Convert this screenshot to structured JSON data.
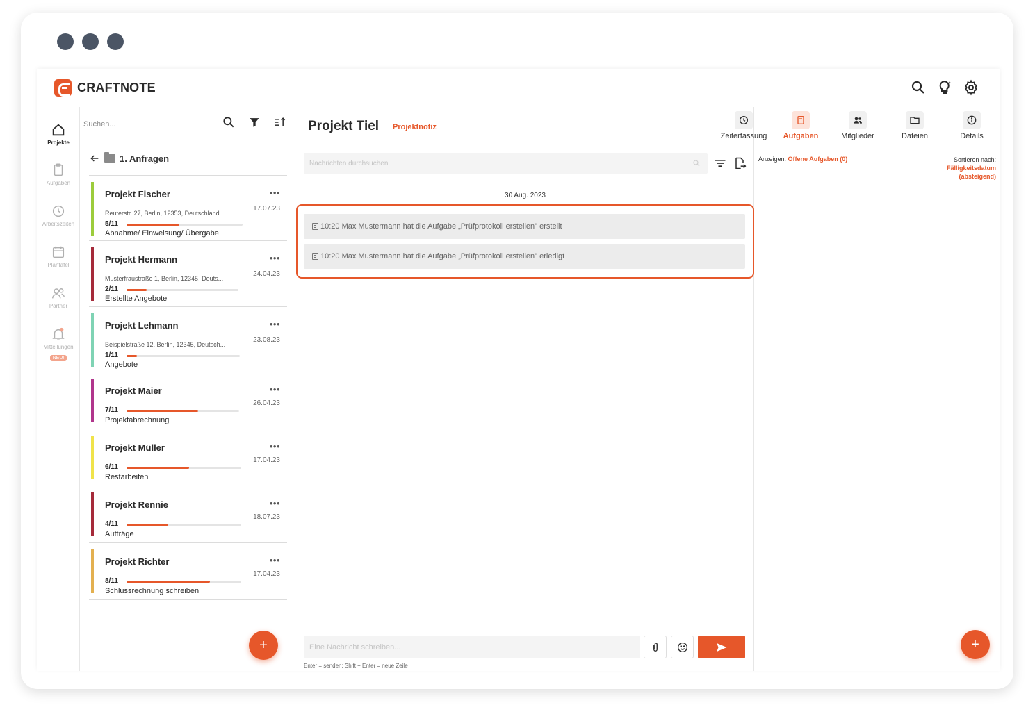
{
  "brand": {
    "name": "CRAFTNOTE",
    "color": "#e6572a"
  },
  "topbar": {
    "icons": [
      "search-icon",
      "lightbulb-icon",
      "gear-icon"
    ]
  },
  "nav": {
    "items": [
      {
        "label": "Projekte",
        "icon": "home-icon",
        "active": true
      },
      {
        "label": "Aufgaben",
        "icon": "clipboard-icon",
        "active": false
      },
      {
        "label": "Arbeitszeiten",
        "icon": "clock-icon",
        "active": false
      },
      {
        "label": "Plantafel",
        "icon": "calendar-icon",
        "active": false
      },
      {
        "label": "Partner",
        "icon": "people-icon",
        "active": false
      },
      {
        "label": "Mitteilungen",
        "icon": "bell-icon",
        "active": false,
        "badge": "NEU!"
      }
    ]
  },
  "list": {
    "search_placeholder": "Suchen...",
    "folder": "1. Anfragen",
    "more": "•••",
    "projects": [
      {
        "name": "Projekt Fischer",
        "address": "Reuterstr. 27, Berlin, 12353, Deutschland",
        "date": "17.07.23",
        "count": "5/11",
        "progress": 0.4545,
        "stage": "Abnahme/ Einweisung/ Übergabe",
        "color": "#9ccc3c"
      },
      {
        "name": "Projekt Hermann",
        "address": "Musterfraustraße 1, Berlin, 12345, Deuts...",
        "date": "24.04.23",
        "count": "2/11",
        "progress": 0.1818,
        "stage": "Erstellte Angebote",
        "color": "#a52a3a"
      },
      {
        "name": "Projekt Lehmann",
        "address": "Beispielstraße 12, Berlin, 12345, Deutsch...",
        "date": "23.08.23",
        "count": "1/11",
        "progress": 0.0909,
        "stage": "Angebote",
        "color": "#7fd3b4"
      },
      {
        "name": "Projekt Maier",
        "address": "",
        "date": "26.04.23",
        "count": "7/11",
        "progress": 0.6364,
        "stage": "Projektabrechnung",
        "color": "#b0358c"
      },
      {
        "name": "Projekt Müller",
        "address": "",
        "date": "17.04.23",
        "count": "6/11",
        "progress": 0.5455,
        "stage": "Restarbeiten",
        "color": "#f0e34a"
      },
      {
        "name": "Projekt Rennie",
        "address": "",
        "date": "18.07.23",
        "count": "4/11",
        "progress": 0.3636,
        "stage": "Aufträge",
        "color": "#a52a3a"
      },
      {
        "name": "Projekt Richter",
        "address": "",
        "date": "17.04.23",
        "count": "8/11",
        "progress": 0.7273,
        "stage": "Schlussrechnung schreiben",
        "color": "#e3b050"
      }
    ],
    "fab": "+"
  },
  "chat": {
    "title": "Projekt Tiel",
    "subtitle": "Projektnotiz",
    "tabs": [
      {
        "label": "Zeiterfassung",
        "icon": "clock-icon",
        "active": false
      },
      {
        "label": "Aufgaben",
        "icon": "tasks-icon",
        "active": true
      },
      {
        "label": "Mitglieder",
        "icon": "members-icon",
        "active": false
      },
      {
        "label": "Dateien",
        "icon": "folder-icon",
        "active": false
      },
      {
        "label": "Details",
        "icon": "info-icon",
        "active": false
      }
    ],
    "search_placeholder": "Nachrichten durchsuchen...",
    "date": "30 Aug. 2023",
    "messages": [
      {
        "text": "10:20 Max Mustermann hat die Aufgabe „Prüfprotokoll erstellen\" erstellt"
      },
      {
        "text": "10:20 Max Mustermann hat die Aufgabe „Prüfprotokoll erstellen\" erledigt"
      }
    ],
    "composer_placeholder": "Eine Nachricht schreiben...",
    "hint": "Enter = senden; Shift + Enter = neue Zeile"
  },
  "tasks": {
    "show_label": "Anzeigen:",
    "show_value": "Offene Aufgaben (0)",
    "sort_label": "Sortieren nach:",
    "sort_value": "Fälligkeitsdatum (absteigend)",
    "fab": "+"
  }
}
